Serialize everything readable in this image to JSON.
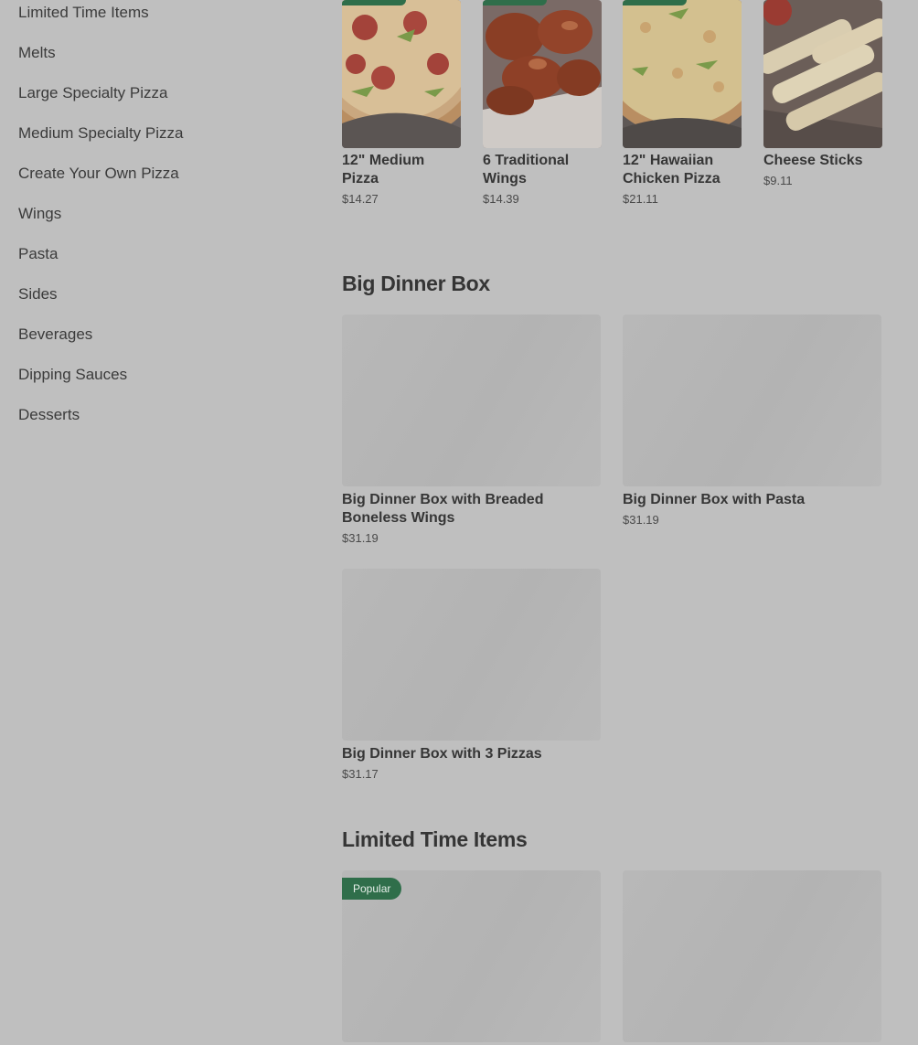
{
  "sidebar": {
    "items": [
      {
        "label": "Limited Time Items"
      },
      {
        "label": "Melts"
      },
      {
        "label": "Large Specialty Pizza"
      },
      {
        "label": "Medium Specialty Pizza"
      },
      {
        "label": "Create Your Own Pizza"
      },
      {
        "label": "Wings"
      },
      {
        "label": "Pasta"
      },
      {
        "label": "Sides"
      },
      {
        "label": "Beverages"
      },
      {
        "label": "Dipping Sauces"
      },
      {
        "label": "Desserts"
      }
    ]
  },
  "popular_strip": {
    "items": [
      {
        "name": "12\" Medium Pizza",
        "price": "$14.27",
        "image": "pepperoni-pizza"
      },
      {
        "name": "6 Traditional Wings",
        "price": "$14.39",
        "image": "wings"
      },
      {
        "name": "12\" Hawaiian Chicken Pizza",
        "price": "$21.11",
        "image": "hawaiian-pizza"
      },
      {
        "name": "Cheese Sticks",
        "price": "$9.11",
        "image": "cheese-sticks"
      }
    ]
  },
  "big_dinner_box": {
    "title": "Big Dinner Box",
    "items": [
      {
        "name": "Big Dinner Box with Breaded Boneless Wings",
        "price": "$31.19"
      },
      {
        "name": "Big Dinner Box with Pasta",
        "price": "$31.19"
      },
      {
        "name": "Big Dinner Box with 3 Pizzas",
        "price": "$31.17"
      }
    ]
  },
  "limited_time": {
    "title": "Limited Time Items",
    "badge": "Popular"
  },
  "colors": {
    "page_bg": "#bfbfbf",
    "accent_green": "#2f6e4a",
    "placeholder": "#b6b6b6"
  }
}
